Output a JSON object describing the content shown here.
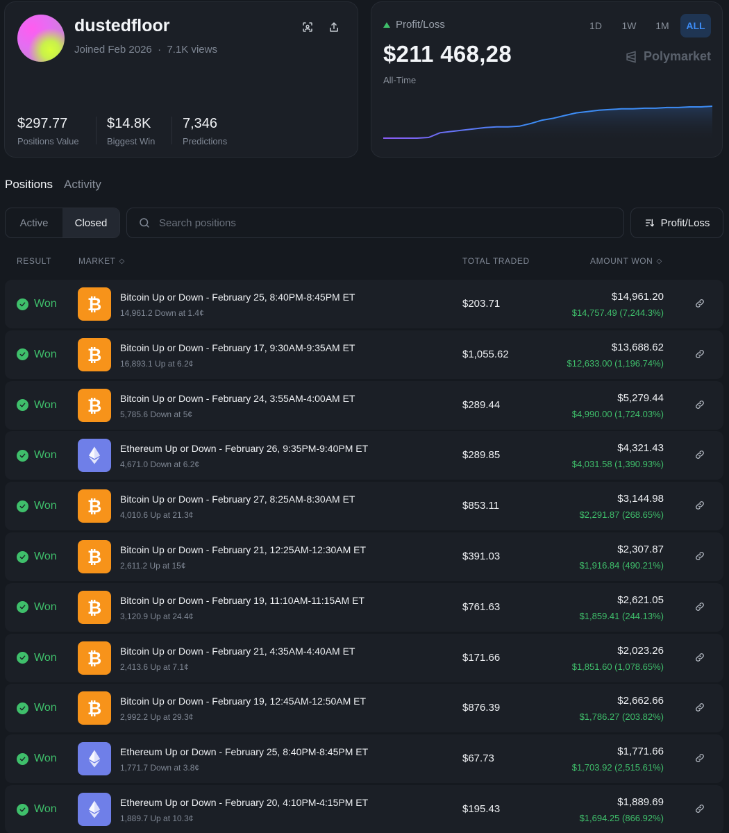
{
  "profile": {
    "username": "dustedfloor",
    "joined": "Joined Feb 2026",
    "views": "7.1K views",
    "stats": [
      {
        "value": "$297.77",
        "label": "Positions Value"
      },
      {
        "value": "$14.8K",
        "label": "Biggest Win"
      },
      {
        "value": "7,346",
        "label": "Predictions"
      }
    ]
  },
  "pnl": {
    "label": "Profit/Loss",
    "value": "$211 468,28",
    "period": "All-Time",
    "brand": "Polymarket",
    "ranges": [
      "1D",
      "1W",
      "1M",
      "ALL"
    ],
    "active_range": "ALL",
    "line_color": "#3d8cf5",
    "line_start_color": "#8b5cf6",
    "series": [
      0,
      0,
      0,
      0,
      1,
      8,
      10,
      12,
      14,
      16,
      17,
      17,
      18,
      22,
      27,
      30,
      34,
      38,
      40,
      42,
      43,
      44,
      44,
      45,
      45,
      46,
      46,
      47,
      47,
      48
    ]
  },
  "tabs": [
    "Positions",
    "Activity"
  ],
  "filters": {
    "active": "Active",
    "closed": "Closed"
  },
  "search": {
    "placeholder": "Search positions"
  },
  "sort": {
    "label": "Profit/Loss"
  },
  "columns": {
    "result": "RESULT",
    "market": "MARKET",
    "traded": "TOTAL TRADED",
    "won": "AMOUNT WON"
  },
  "rows": [
    {
      "result": "Won",
      "coin": "btc",
      "title": "Bitcoin Up or Down - February 25, 8:40PM-8:45PM ET",
      "sub": "14,961.2 Down at 1.4¢",
      "traded": "$203.71",
      "won": "$14,961.20",
      "pnl": "$14,757.49 (7,244.3%)"
    },
    {
      "result": "Won",
      "coin": "btc",
      "title": "Bitcoin Up or Down - February 17, 9:30AM-9:35AM ET",
      "sub": "16,893.1 Up at 6.2¢",
      "traded": "$1,055.62",
      "won": "$13,688.62",
      "pnl": "$12,633.00 (1,196.74%)"
    },
    {
      "result": "Won",
      "coin": "btc",
      "title": "Bitcoin Up or Down - February 24, 3:55AM-4:00AM ET",
      "sub": "5,785.6 Down at 5¢",
      "traded": "$289.44",
      "won": "$5,279.44",
      "pnl": "$4,990.00 (1,724.03%)"
    },
    {
      "result": "Won",
      "coin": "eth",
      "title": "Ethereum Up or Down - February 26, 9:35PM-9:40PM ET",
      "sub": "4,671.0 Down at 6.2¢",
      "traded": "$289.85",
      "won": "$4,321.43",
      "pnl": "$4,031.58 (1,390.93%)"
    },
    {
      "result": "Won",
      "coin": "btc",
      "title": "Bitcoin Up or Down - February 27, 8:25AM-8:30AM ET",
      "sub": "4,010.6 Up at 21.3¢",
      "traded": "$853.11",
      "won": "$3,144.98",
      "pnl": "$2,291.87 (268.65%)"
    },
    {
      "result": "Won",
      "coin": "btc",
      "title": "Bitcoin Up or Down - February 21, 12:25AM-12:30AM ET",
      "sub": "2,611.2 Up at 15¢",
      "traded": "$391.03",
      "won": "$2,307.87",
      "pnl": "$1,916.84 (490.21%)"
    },
    {
      "result": "Won",
      "coin": "btc",
      "title": "Bitcoin Up or Down - February 19, 11:10AM-11:15AM ET",
      "sub": "3,120.9 Up at 24.4¢",
      "traded": "$761.63",
      "won": "$2,621.05",
      "pnl": "$1,859.41 (244.13%)"
    },
    {
      "result": "Won",
      "coin": "btc",
      "title": "Bitcoin Up or Down - February 21, 4:35AM-4:40AM ET",
      "sub": "2,413.6 Up at 7.1¢",
      "traded": "$171.66",
      "won": "$2,023.26",
      "pnl": "$1,851.60 (1,078.65%)"
    },
    {
      "result": "Won",
      "coin": "btc",
      "title": "Bitcoin Up or Down - February 19, 12:45AM-12:50AM ET",
      "sub": "2,992.2 Up at 29.3¢",
      "traded": "$876.39",
      "won": "$2,662.66",
      "pnl": "$1,786.27 (203.82%)"
    },
    {
      "result": "Won",
      "coin": "eth",
      "title": "Ethereum Up or Down - February 25, 8:40PM-8:45PM ET",
      "sub": "1,771.7 Down at 3.8¢",
      "traded": "$67.73",
      "won": "$1,771.66",
      "pnl": "$1,703.92 (2,515.61%)"
    },
    {
      "result": "Won",
      "coin": "eth",
      "title": "Ethereum Up or Down - February 20, 4:10PM-4:15PM ET",
      "sub": "1,889.7 Up at 10.3¢",
      "traded": "$195.43",
      "won": "$1,889.69",
      "pnl": "$1,694.25 (866.92%)"
    }
  ]
}
